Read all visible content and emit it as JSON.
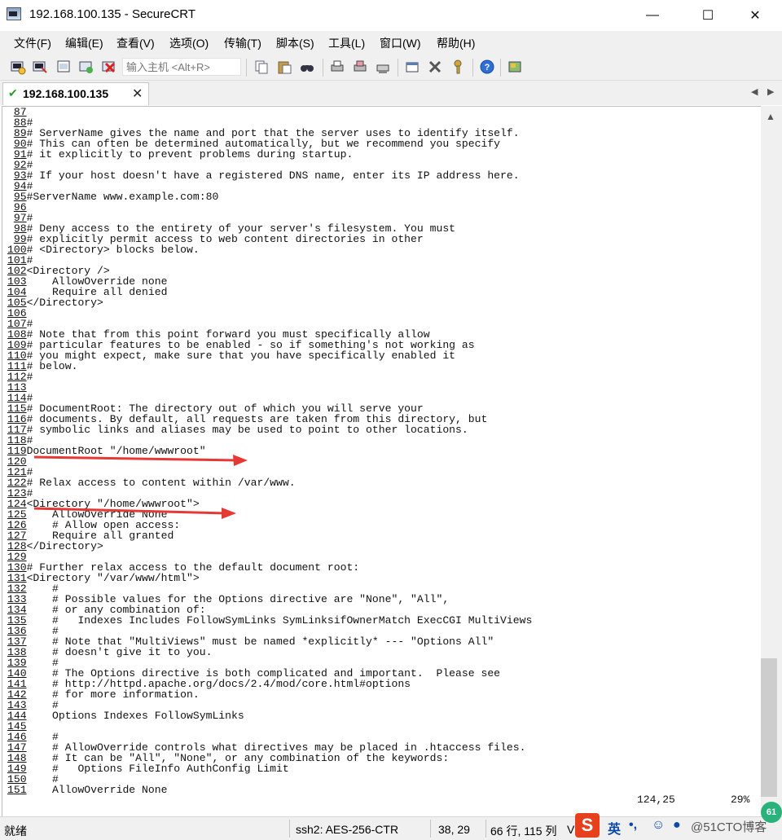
{
  "window": {
    "title": "192.168.100.135 - SecureCRT",
    "minimize": "—",
    "maximize": "☐",
    "close": "✕"
  },
  "menu": [
    "文件(F)",
    "编辑(E)",
    "查看(V)",
    "选项(O)",
    "传输(T)",
    "脚本(S)",
    "工具(L)",
    "窗口(W)",
    "帮助(H)"
  ],
  "toolbar": {
    "host_placeholder": "输入主机 <Alt+R>"
  },
  "tab": {
    "label": "192.168.100.135",
    "close": "✕"
  },
  "terminal": {
    "lines": [
      {
        "n": "87",
        "t": ""
      },
      {
        "n": "88",
        "t": "#"
      },
      {
        "n": "89",
        "t": "# ServerName gives the name and port that the server uses to identify itself."
      },
      {
        "n": "90",
        "t": "# This can often be determined automatically, but we recommend you specify"
      },
      {
        "n": "91",
        "t": "# it explicitly to prevent problems during startup."
      },
      {
        "n": "92",
        "t": "#"
      },
      {
        "n": "93",
        "t": "# If your host doesn't have a registered DNS name, enter its IP address here."
      },
      {
        "n": "94",
        "t": "#"
      },
      {
        "n": "95",
        "t": "#ServerName www.example.com:80"
      },
      {
        "n": "96",
        "t": ""
      },
      {
        "n": "97",
        "t": "#"
      },
      {
        "n": "98",
        "t": "# Deny access to the entirety of your server's filesystem. You must"
      },
      {
        "n": "99",
        "t": "# explicitly permit access to web content directories in other"
      },
      {
        "n": "100",
        "t": "# <Directory> blocks below."
      },
      {
        "n": "101",
        "t": "#"
      },
      {
        "n": "102",
        "t": "<Directory />"
      },
      {
        "n": "103",
        "t": "    AllowOverride none"
      },
      {
        "n": "104",
        "t": "    Require all denied"
      },
      {
        "n": "105",
        "t": "</Directory>"
      },
      {
        "n": "106",
        "t": ""
      },
      {
        "n": "107",
        "t": "#"
      },
      {
        "n": "108",
        "t": "# Note that from this point forward you must specifically allow"
      },
      {
        "n": "109",
        "t": "# particular features to be enabled - so if something's not working as"
      },
      {
        "n": "110",
        "t": "# you might expect, make sure that you have specifically enabled it"
      },
      {
        "n": "111",
        "t": "# below."
      },
      {
        "n": "112",
        "t": "#"
      },
      {
        "n": "113",
        "t": ""
      },
      {
        "n": "114",
        "t": "#"
      },
      {
        "n": "115",
        "t": "# DocumentRoot: The directory out of which you will serve your"
      },
      {
        "n": "116",
        "t": "# documents. By default, all requests are taken from this directory, but"
      },
      {
        "n": "117",
        "t": "# symbolic links and aliases may be used to point to other locations."
      },
      {
        "n": "118",
        "t": "#"
      },
      {
        "n": "119",
        "t": "DocumentRoot \"/home/wwwroot\""
      },
      {
        "n": "120",
        "t": ""
      },
      {
        "n": "121",
        "t": "#"
      },
      {
        "n": "122",
        "t": "# Relax access to content within /var/www."
      },
      {
        "n": "123",
        "t": "#"
      },
      {
        "n": "124",
        "t": "<Directory \"/home/wwwroot\">"
      },
      {
        "n": "125",
        "t": "    AllowOverride None"
      },
      {
        "n": "126",
        "t": "    # Allow open access:"
      },
      {
        "n": "127",
        "t": "    Require all granted"
      },
      {
        "n": "128",
        "t": "</Directory>"
      },
      {
        "n": "129",
        "t": ""
      },
      {
        "n": "130",
        "t": "# Further relax access to the default document root:"
      },
      {
        "n": "131",
        "t": "<Directory \"/var/www/html\">"
      },
      {
        "n": "132",
        "t": "    #"
      },
      {
        "n": "133",
        "t": "    # Possible values for the Options directive are \"None\", \"All\","
      },
      {
        "n": "134",
        "t": "    # or any combination of:"
      },
      {
        "n": "135",
        "t": "    #   Indexes Includes FollowSymLinks SymLinksifOwnerMatch ExecCGI MultiViews"
      },
      {
        "n": "136",
        "t": "    #"
      },
      {
        "n": "137",
        "t": "    # Note that \"MultiViews\" must be named *explicitly* --- \"Options All\""
      },
      {
        "n": "138",
        "t": "    # doesn't give it to you."
      },
      {
        "n": "139",
        "t": "    #"
      },
      {
        "n": "140",
        "t": "    # The Options directive is both complicated and important.  Please see"
      },
      {
        "n": "141",
        "t": "    # http://httpd.apache.org/docs/2.4/mod/core.html#options"
      },
      {
        "n": "142",
        "t": "    # for more information."
      },
      {
        "n": "143",
        "t": "    #"
      },
      {
        "n": "144",
        "t": "    Options Indexes FollowSymLinks"
      },
      {
        "n": "145",
        "t": ""
      },
      {
        "n": "146",
        "t": "    #"
      },
      {
        "n": "147",
        "t": "    # AllowOverride controls what directives may be placed in .htaccess files."
      },
      {
        "n": "148",
        "t": "    # It can be \"All\", \"None\", or any combination of the keywords:"
      },
      {
        "n": "149",
        "t": "    #   Options FileInfo AuthConfig Limit"
      },
      {
        "n": "150",
        "t": "    #"
      },
      {
        "n": "151",
        "t": "    AllowOverride None"
      }
    ],
    "cursor_position": "124,25",
    "scroll_percent": "29%"
  },
  "status": {
    "ready": "就绪",
    "cipher": "ssh2: AES-256-CTR",
    "cursor": "38, 29",
    "size": "66 行, 115 列",
    "mode": "V"
  },
  "ime": {
    "lang": "英",
    "watermark": "@51CTO博客",
    "badge": "61"
  },
  "colors": {
    "annotation_arrow": "#e53935",
    "ime_logo": "#e8401c"
  }
}
